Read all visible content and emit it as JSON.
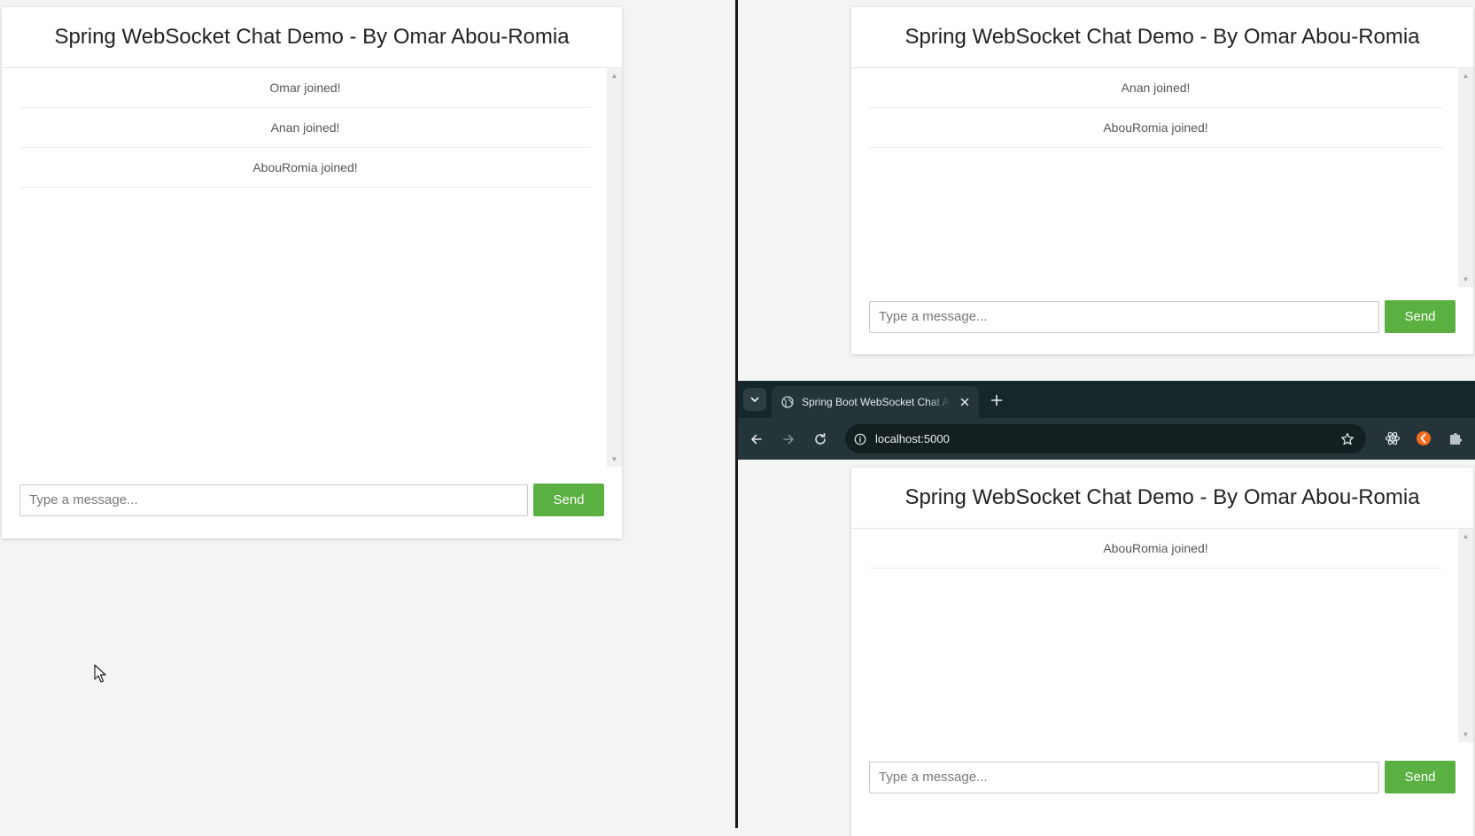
{
  "title": "Spring WebSocket Chat Demo - By Omar Abou-Romia",
  "placeholder": "Type a message...",
  "send_label": "Send",
  "left_chat": {
    "messages": [
      "Omar joined!",
      "Anan joined!",
      "AbouRomia joined!"
    ]
  },
  "right_top_chat": {
    "messages": [
      "Anan joined!",
      "AbouRomia joined!"
    ]
  },
  "browser": {
    "tab_title": "Spring Boot WebSocket Chat App",
    "url": "localhost:5000",
    "chat": {
      "messages": [
        "AbouRomia joined!"
      ]
    }
  },
  "colors": {
    "send_button": "#5ab040",
    "page_background": "#f4f4f4",
    "browser_frame": "#16262a",
    "browser_toolbar": "#243438"
  }
}
